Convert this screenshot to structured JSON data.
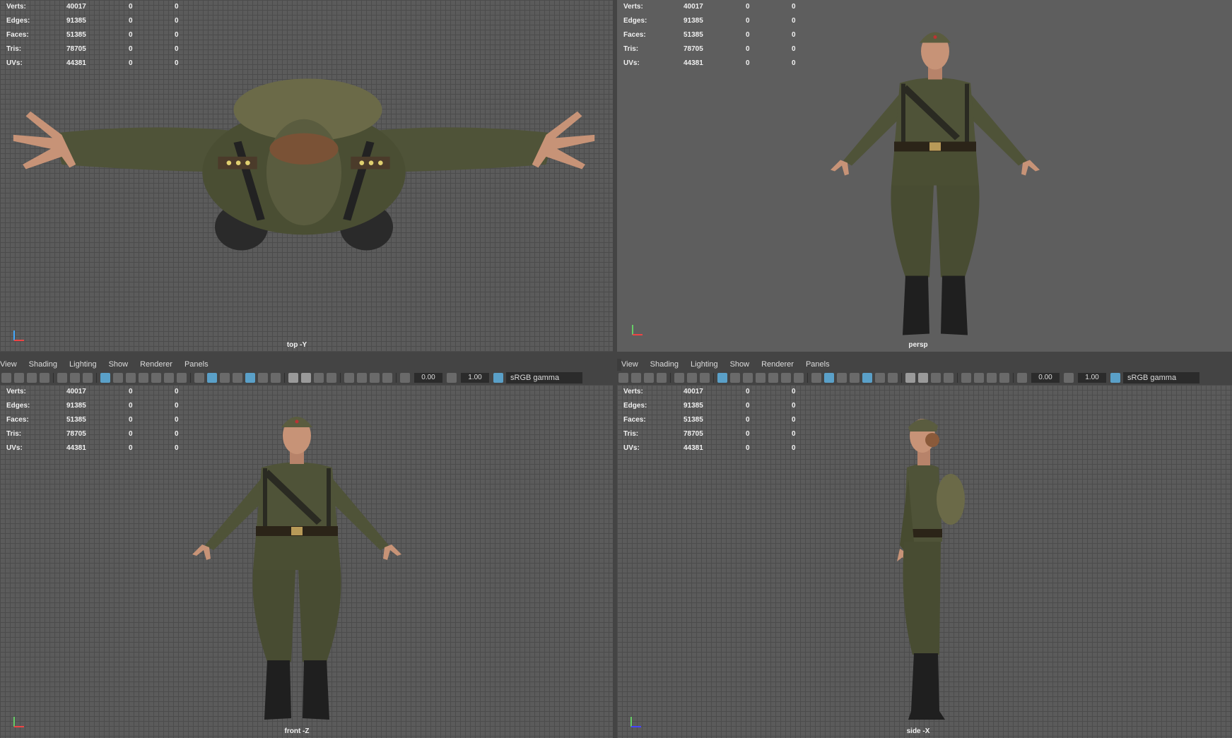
{
  "stats": {
    "rows": [
      {
        "label": "Verts:",
        "v1": "40017",
        "v2": "0",
        "v3": "0"
      },
      {
        "label": "Edges:",
        "v1": "91385",
        "v2": "0",
        "v3": "0"
      },
      {
        "label": "Faces:",
        "v1": "51385",
        "v2": "0",
        "v3": "0"
      },
      {
        "label": "Tris:",
        "v1": "78705",
        "v2": "0",
        "v3": "0"
      },
      {
        "label": "UVs:",
        "v1": "44381",
        "v2": "0",
        "v3": "0"
      }
    ]
  },
  "viewports": {
    "top": {
      "camera": "top -Y"
    },
    "persp": {
      "camera": "persp"
    },
    "front": {
      "camera": "front -Z"
    },
    "side": {
      "camera": "side -X"
    }
  },
  "menu": [
    "View",
    "Shading",
    "Lighting",
    "Show",
    "Renderer",
    "Panels"
  ],
  "toolbar": {
    "exposure": "0.00",
    "gamma_value": "1.00",
    "color_space": "sRGB gamma"
  },
  "colors": {
    "uniform": "#4f5338",
    "uniform_dark": "#3d412b",
    "boots": "#1f1f1f",
    "skin": "#c79377",
    "cap": "#5a5c3f",
    "accent": "#5aa0c8"
  },
  "icons": {
    "axis": "axis-gizmo-icon",
    "camera": "camera-icon"
  }
}
